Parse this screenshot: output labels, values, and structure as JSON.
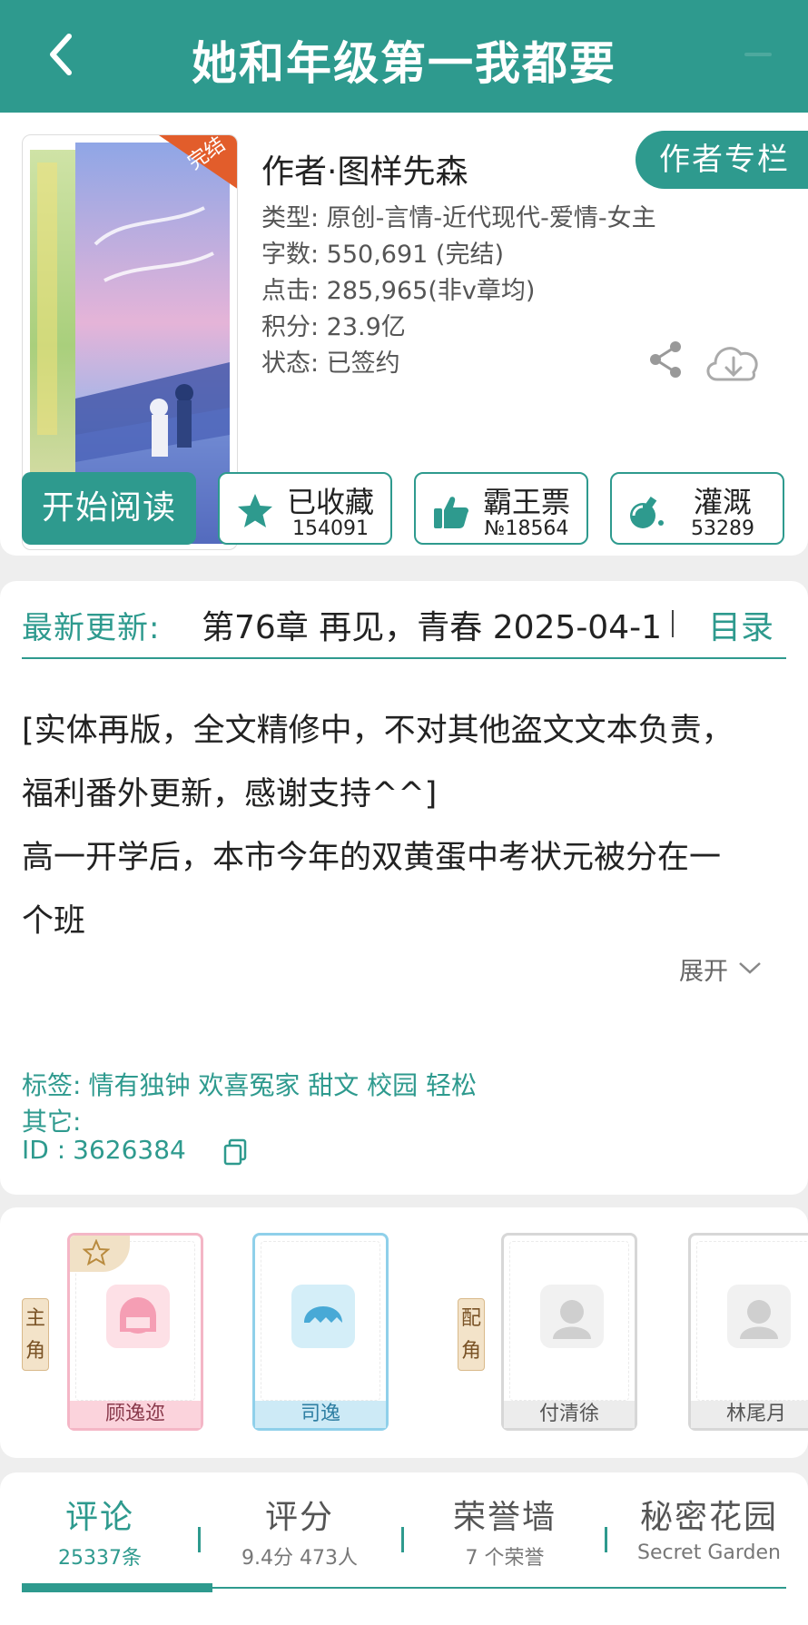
{
  "header": {
    "title": "她和年级第一我都要"
  },
  "book": {
    "cover_badge": "完结",
    "author": "作者·图样先森",
    "author_column_label": "作者专栏",
    "meta": [
      "类型: 原创-言情-近代现代-爱情-女主",
      "字数: 550,691 (完结)",
      "点击: 285,965(非v章均)",
      "积分: 23.9亿",
      "状态: 已签约"
    ]
  },
  "actions": {
    "start_reading": "开始阅读",
    "collect": {
      "label": "已收藏",
      "count": "154091"
    },
    "ticket": {
      "label": "霸王票",
      "count": "№18564"
    },
    "irrigate": {
      "label": "灌溉",
      "count": "53289"
    }
  },
  "update": {
    "label": "最新更新:",
    "text": "第76章  再见，青春  2025-04-1",
    "toc": "目录"
  },
  "description": {
    "lines": [
      "[实体再版，全文精修中，不对其他盗文文本负责，",
      "福利番外更新，感谢支持^^]",
      "高一开学后，本市今年的双黄蛋中考状元被分在一",
      "个班"
    ],
    "expand": "展开"
  },
  "tags": {
    "tags_label": "标签:",
    "tags_value": "情有独钟 欢喜冤家 甜文 校园 轻松",
    "other_label": "其它:",
    "other_value": "",
    "id_label": "ID  :",
    "id_value": "3626384"
  },
  "roles": {
    "main_tag": "主角",
    "support_tag": "配角",
    "main": [
      {
        "name": "顾逸迩",
        "style": "pink"
      },
      {
        "name": "司逸",
        "style": "blue"
      }
    ],
    "support": [
      {
        "name": "付清徐"
      },
      {
        "name": "林尾月"
      }
    ]
  },
  "tabs": [
    {
      "title": "评论",
      "sub": "25337条",
      "active": true
    },
    {
      "title": "评分",
      "sub": "9.4分 473人",
      "active": false
    },
    {
      "title": "荣誉墙",
      "sub": "7 个荣誉",
      "active": false
    },
    {
      "title": "秘密花园",
      "sub": "Secret Garden",
      "active": false
    }
  ],
  "colors": {
    "accent": "#2e9a8e",
    "header_bg": "#2e9a8e",
    "page_bg": "#eeeeee"
  }
}
